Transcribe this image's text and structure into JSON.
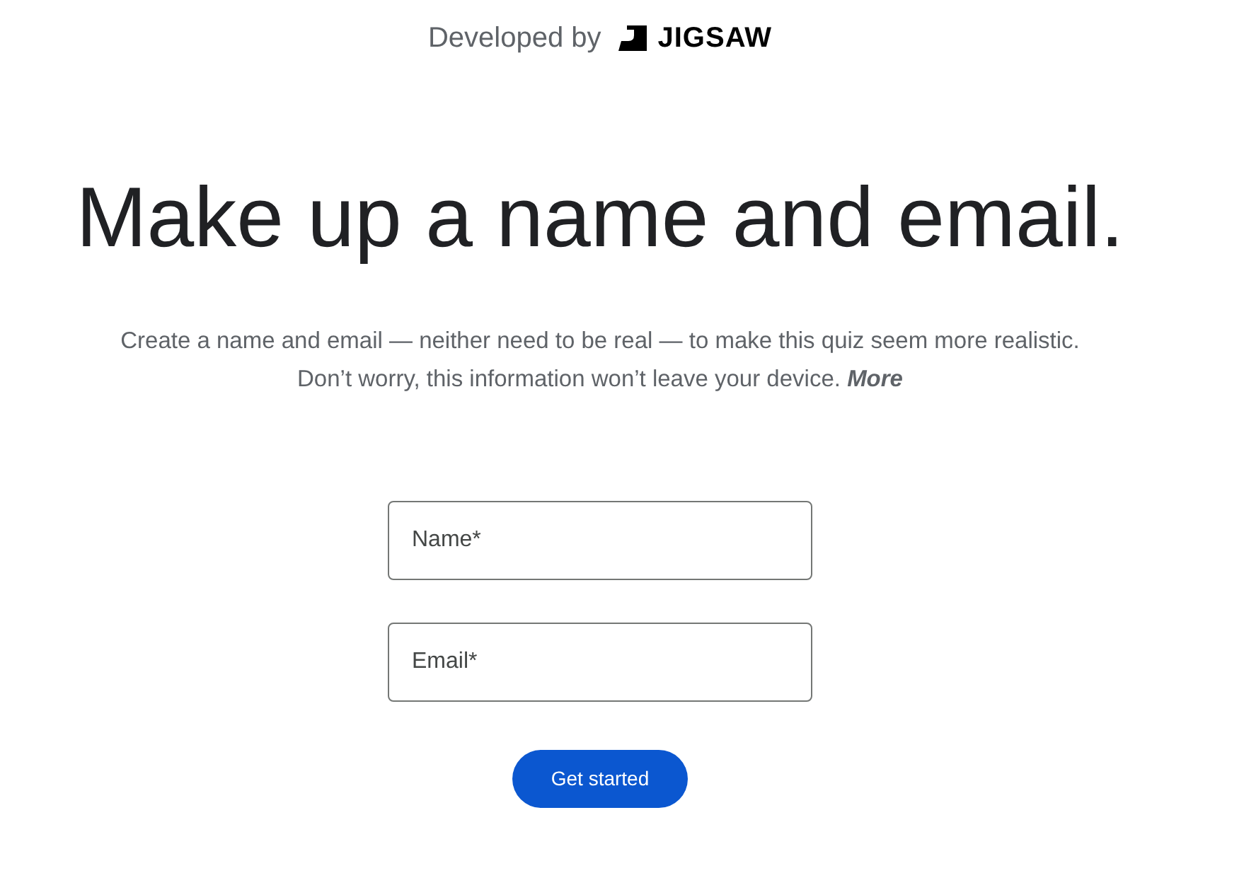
{
  "header": {
    "prefix": "Developed by",
    "brand": "JIGSAW"
  },
  "title": "Make up a name and email.",
  "intro": {
    "lines": [
      "Create a name and email — neither need to be real — to make this quiz seem more realistic.",
      "Don’t worry, this information won’t leave your device."
    ],
    "link": "More"
  },
  "fields": [
    {
      "placeholder": "Name*"
    },
    {
      "placeholder": "Email*"
    }
  ],
  "button": "Get started"
}
